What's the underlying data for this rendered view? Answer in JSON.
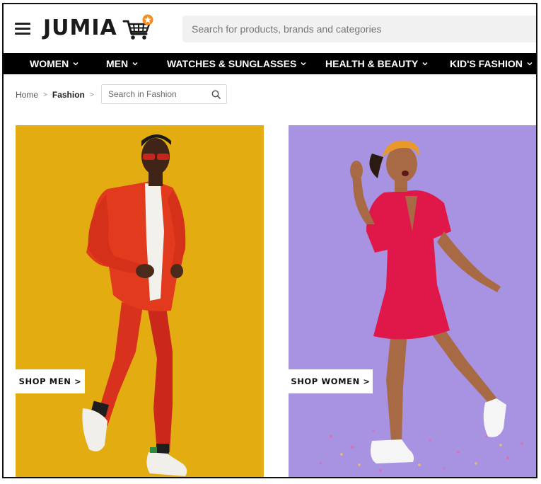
{
  "header": {
    "menu_icon": "hamburger-menu-icon",
    "logo_text": "JUMIA",
    "logo_icon": "shopping-cart-star-icon",
    "brand_colors": {
      "orange": "#f68b1e",
      "dark": "#1a1a1a"
    },
    "search_placeholder": "Search for products, brands and categories"
  },
  "nav": {
    "items": [
      {
        "label": "WOMEN"
      },
      {
        "label": "MEN"
      },
      {
        "label": "WATCHES & SUNGLASSES"
      },
      {
        "label": "HEALTH & BEAUTY"
      },
      {
        "label": "KID'S FASHION"
      }
    ],
    "chevron_icon": "chevron-down-icon"
  },
  "breadcrumb": {
    "home": "Home",
    "separator": ">",
    "current": "Fashion",
    "search_placeholder": "Search in Fashion",
    "search_icon": "search-icon"
  },
  "panels": {
    "men": {
      "button_label": "SHOP MEN >",
      "background": "#e3ad12"
    },
    "women": {
      "button_label": "SHOP WOMEN >",
      "background": "#a893e2"
    }
  }
}
